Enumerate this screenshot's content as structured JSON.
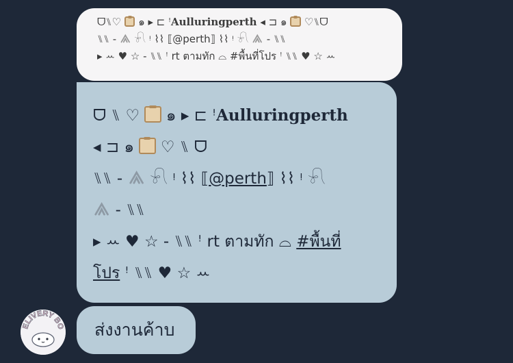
{
  "quote": {
    "line1": "ᗜ⑊♡",
    "line1b": "๑ ▸ ⊏ ꜝ",
    "line1_name": "Aulluringperth",
    "line1c": "◂ ⊐ ๑",
    "line1d": "♡⑊ᗜ",
    "line2a": "⑊⑊ ‐ ",
    "line2b": " 𓍯 ᵎ ⌇⌇ ⟦@perth⟧ ⌇⌇ ᵎ 𓍯 ",
    "line2c": " ‐ ⑊⑊",
    "line3": "▸ ꕀ ♥ ☆ ‐ ⑊⑊ ꜝ rt ตามทัก ⌓ #พื้นที่โปร ꜝ ⑊⑊ ♥ ☆ ꕀ"
  },
  "message": {
    "line1a": "ᗜ ⑊ ♡",
    "line1b": " ๑ ▸ ⊏ ꜝ",
    "name": "Aulluringperth",
    "line2a": "◂ ⊐ ๑ ",
    "line2b": "♡ ⑊ ᗜ",
    "line3a": "⑊⑊ ‐ ",
    "line3b": " 𓍯 ᵎ ⌇⌇ ⟦",
    "mention": "@perth",
    "line3c": "⟧ ⌇⌇ ᵎ 𓍯",
    "line4": " ‐ ⑊⑊",
    "line5a": "▸ ꕀ ♥ ☆ ‐ ⑊⑊ ꜝ rt ตามทัก ⌓ ",
    "hashtag_part1": "#พื้นที่",
    "hashtag_part2": "โปร",
    "line6": " ꜝ ⑊⑊ ♥ ☆ ꕀ"
  },
  "reply": {
    "text": "ส่งงานค้าบ"
  },
  "avatar": {
    "text": "DELIVERY BOX"
  },
  "colors": {
    "background": "#1e2838",
    "bubble": "#b8ccd8",
    "quote_bubble": "#f6f5f6"
  }
}
